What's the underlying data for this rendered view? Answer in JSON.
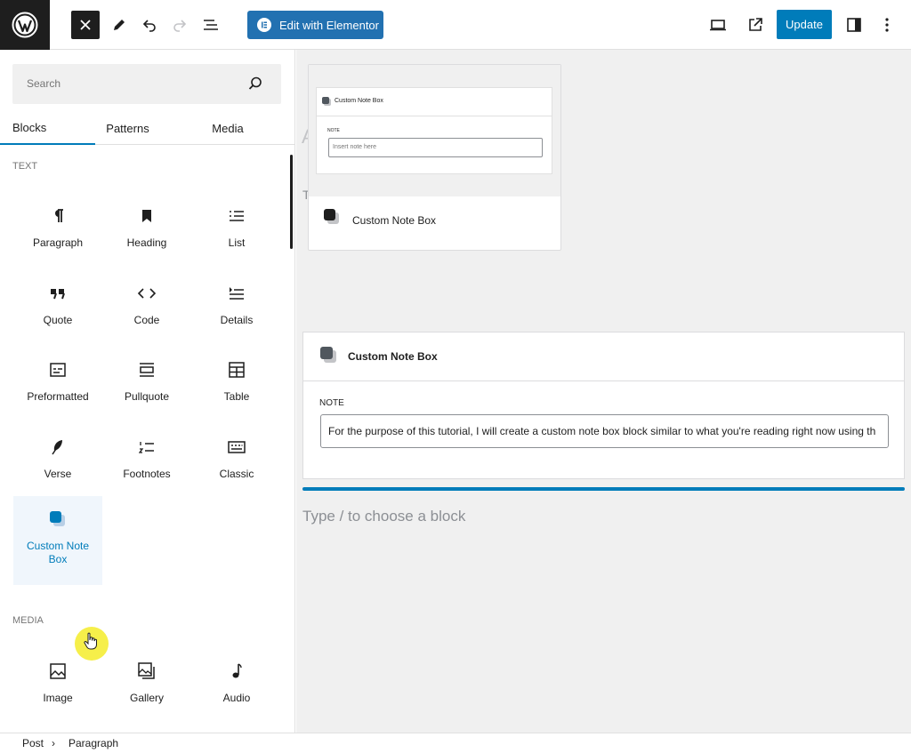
{
  "toolbar": {
    "elementor_label": "Edit with Elementor",
    "update_label": "Update"
  },
  "sidebar": {
    "search_placeholder": "Search",
    "tabs": [
      {
        "label": "Blocks"
      },
      {
        "label": "Patterns"
      },
      {
        "label": "Media"
      }
    ],
    "text_category": "TEXT",
    "text_blocks": [
      {
        "label": "Paragraph",
        "icon": "paragraph-icon"
      },
      {
        "label": "Heading",
        "icon": "bookmark-icon"
      },
      {
        "label": "List",
        "icon": "list-icon"
      },
      {
        "label": "Quote",
        "icon": "quote-icon"
      },
      {
        "label": "Code",
        "icon": "code-icon"
      },
      {
        "label": "Details",
        "icon": "details-icon"
      },
      {
        "label": "Preformatted",
        "icon": "preformatted-icon"
      },
      {
        "label": "Pullquote",
        "icon": "pullquote-icon"
      },
      {
        "label": "Table",
        "icon": "table-icon"
      },
      {
        "label": "Verse",
        "icon": "feather-icon"
      },
      {
        "label": "Footnotes",
        "icon": "footnotes-icon"
      },
      {
        "label": "Classic",
        "icon": "keyboard-icon"
      }
    ],
    "custom_block": {
      "label_line1": "Custom Note",
      "label_line2": "Box",
      "icon": "note-box-icon"
    },
    "media_category": "MEDIA",
    "media_blocks": [
      {
        "label": "Image",
        "icon": "image-icon"
      },
      {
        "label": "Gallery",
        "icon": "gallery-icon"
      },
      {
        "label": "Audio",
        "icon": "audio-icon"
      }
    ]
  },
  "preview": {
    "mini_title": "Custom Note Box",
    "mini_note_label": "NOTE",
    "mini_placeholder": "Insert note here",
    "label": "Custom Note Box"
  },
  "canvas": {
    "ghost_letter_a": "A",
    "ghost_letter_t": "T",
    "note_block": {
      "title": "Custom Note Box",
      "note_label": "NOTE",
      "note_value": "For the purpose of this tutorial, I will create a custom note box block similar to what you're reading right now using th"
    },
    "placeholder": "Type / to choose a block"
  },
  "breadcrumb": {
    "items": [
      "Post",
      "Paragraph"
    ],
    "separator": "›"
  },
  "colors": {
    "accent": "#007cba",
    "elementor": "#2271b1",
    "cursor_highlight": "#f6ef4a"
  }
}
